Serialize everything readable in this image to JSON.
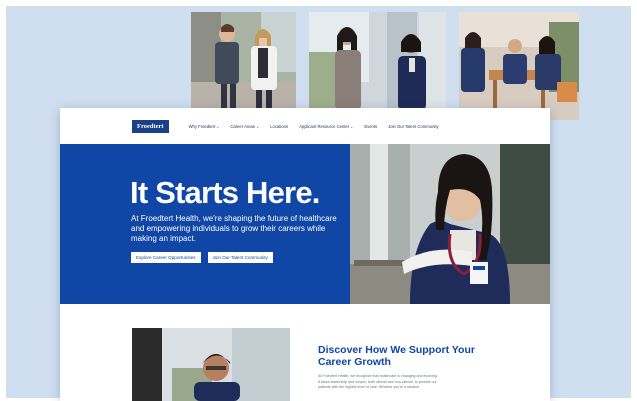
{
  "nav": {
    "logo": "Froedtert",
    "items": [
      {
        "label": "Why Froedtert",
        "dropdown": true
      },
      {
        "label": "Career Areas",
        "dropdown": true
      },
      {
        "label": "Locations",
        "dropdown": false
      },
      {
        "label": "Applicant Resource Center",
        "dropdown": true
      },
      {
        "label": "Events",
        "dropdown": false
      },
      {
        "label": "Join Our Talent Community",
        "dropdown": false
      }
    ]
  },
  "hero": {
    "title": "It Starts Here.",
    "text": "At Froedtert Health, we're shaping the future of healthcare and empowering individuals to grow their careers while making an impact.",
    "buttons": {
      "explore": "Explore Career Opportunities",
      "join": "Join Our Talent Community"
    }
  },
  "section": {
    "title": "Discover How We Support Your Career Growth",
    "body": "At Froedtert Health, we recognize that healthcare is changing and evolving. It takes leadership and unique, both clinical and non-clinical, to provide our patients with the highest level of care. Whether you're a student"
  },
  "colors": {
    "brand_blue": "#1046a5",
    "logo_navy": "#1c3f8a",
    "panel_bg": "#cfdff0"
  },
  "icons": {
    "dropdown": "chevron-down-icon"
  }
}
